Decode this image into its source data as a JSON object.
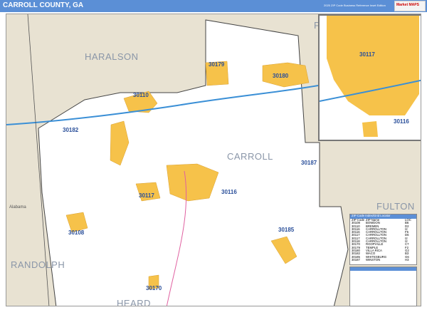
{
  "header": {
    "title": "CARROLL COUNTY, GA",
    "edition": "2025 ZIP Code Business Reference Inset Edition",
    "logo_text": "Market MAPS"
  },
  "counties": [
    "HARALSON",
    "CARROLL",
    "FULTON",
    "RANDOLPH",
    "HEARD",
    "P"
  ],
  "places": [
    "Alabama"
  ],
  "zip_labels": [
    "30179",
    "30180",
    "30110",
    "30182",
    "30117",
    "30116",
    "30187",
    "30108",
    "30185",
    "30170"
  ],
  "inset": {
    "zip_labels": [
      "30117",
      "30116"
    ]
  },
  "legend": {
    "title": "ZIP Code Index/Grid Locator",
    "columns": [
      "ZIP Code",
      "ZIP Name",
      "LOC"
    ],
    "rows": [
      [
        "30108",
        "BOWDON",
        "B6"
      ],
      [
        "30110",
        "BREMEN",
        "D2"
      ],
      [
        "30116",
        "CARROLLTON",
        "I2"
      ],
      [
        "30116",
        "CARROLLTON",
        "F5"
      ],
      [
        "30117",
        "CARROLLTON",
        "D6"
      ],
      [
        "30117",
        "CARROLLTON",
        "I2"
      ],
      [
        "30118",
        "CARROLLTON",
        "I2"
      ],
      [
        "30170",
        "ROOPVILLE",
        "C7"
      ],
      [
        "30179",
        "TEMPLE",
        "F2"
      ],
      [
        "30180",
        "VILLA RICA",
        "G2"
      ],
      [
        "30182",
        "WACO",
        "B3"
      ],
      [
        "30185",
        "WHITESBURG",
        "G6"
      ],
      [
        "30187",
        "WINSTON",
        "H3"
      ]
    ]
  }
}
